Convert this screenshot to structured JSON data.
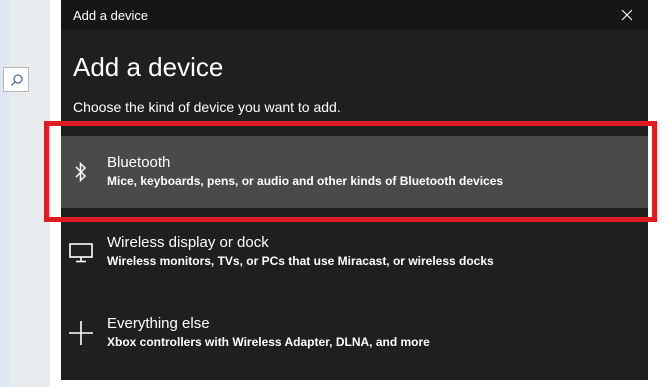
{
  "dialog": {
    "window_title": "Add a device",
    "close_icon": "close-icon",
    "heading": "Add a device",
    "subtitle": "Choose the kind of device you want to add."
  },
  "options": [
    {
      "icon": "bluetooth-icon",
      "title": "Bluetooth",
      "description": "Mice, keyboards, pens, or audio and other kinds of Bluetooth devices",
      "selected": true
    },
    {
      "icon": "monitor-icon",
      "title": "Wireless display or dock",
      "description": "Wireless monitors, TVs, or PCs that use Miracast, or wireless docks",
      "selected": false
    },
    {
      "icon": "plus-icon",
      "title": "Everything else",
      "description": "Xbox controllers with Wireless Adapter, DLNA, and more",
      "selected": false
    }
  ],
  "background": {
    "search_icon": "search-icon"
  },
  "colors": {
    "dialog_bg": "#1f1f1f",
    "titlebar_bg": "#161616",
    "selected_row_bg": "#4a4a4a",
    "highlight_border": "#e01b22"
  }
}
